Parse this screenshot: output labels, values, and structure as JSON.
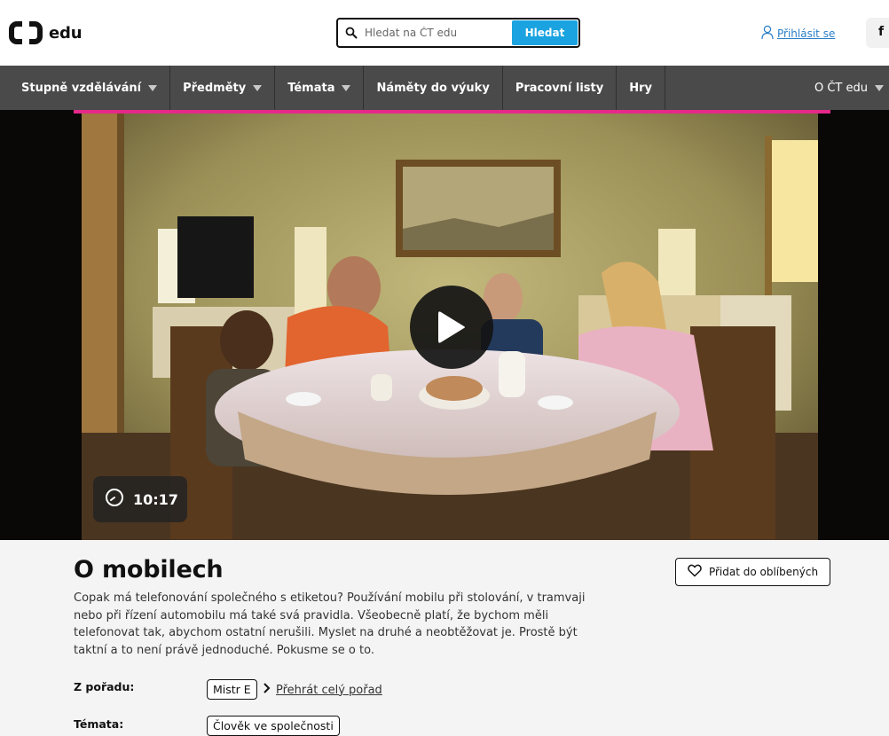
{
  "header": {
    "logo_text": "edu",
    "search": {
      "placeholder": "Hledat na ČT edu",
      "button_label": "Hledat"
    },
    "login_label": "Přihlásit se",
    "social_label": "f"
  },
  "nav": {
    "items": [
      {
        "label": "Stupně vzdělávání",
        "has_dropdown": true
      },
      {
        "label": "Předměty",
        "has_dropdown": true
      },
      {
        "label": "Témata",
        "has_dropdown": true
      },
      {
        "label": "Náměty do výuky",
        "has_dropdown": false
      },
      {
        "label": "Pracovní listy",
        "has_dropdown": false
      },
      {
        "label": "Hry",
        "has_dropdown": false
      }
    ],
    "right_label": "O ČT edu"
  },
  "video": {
    "duration": "10:17"
  },
  "article": {
    "title": "O mobilech",
    "favorite_label": "Přidat do oblíbených",
    "description": "Copak má telefonování společného s etiketou? Používání mobilu při stolování, v tramvaji nebo při řízení automobilu má také svá pravidla. Všeobecně platí, že bychom měli telefonovat tak, abychom ostatní nerušili. Myslet na druhé a neobtěžovat je. Prostě být taktní a to není právě jednoduché. Pokusme se o to.",
    "show_label": "Z pořadu:",
    "show_tag": "Mistr E",
    "play_all_label": "Přehrát celý pořad",
    "topics_label": "Témata:",
    "topic_tag": "Člověk ve společnosti"
  },
  "colors": {
    "accent_pink": "#e6288b",
    "search_blue": "#1aa3e0",
    "nav_bg": "#4a4a4a"
  }
}
